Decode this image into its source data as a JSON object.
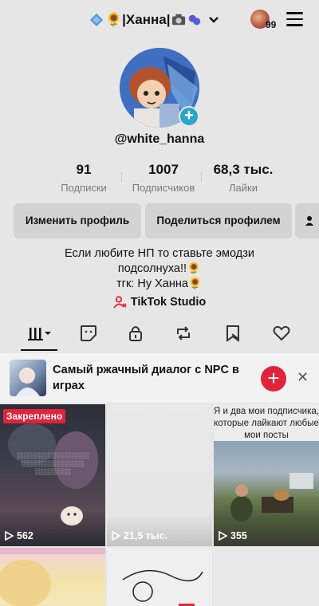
{
  "header": {
    "account_name": "🌻|Ханна|",
    "notifications_count": "99"
  },
  "profile": {
    "username": "@white_hanna",
    "stats": [
      {
        "value": "91",
        "label": "Подписки"
      },
      {
        "value": "1007",
        "label": "Подписчиков"
      },
      {
        "value": "68,3 тыс.",
        "label": "Лайки"
      }
    ],
    "edit_button": "Изменить профиль",
    "share_button": "Поделиться профилем",
    "bio": [
      "Если любите НП то ставьте эмодзи",
      "подсолнуха!!🌻",
      "тгк: Ну Ханна🌻"
    ],
    "studio_link": "TikTok Studio"
  },
  "playlist_banner": {
    "title": "Самый ржачный диалог с NPC в играх"
  },
  "videos": [
    {
      "pinned_label": "Закреплено",
      "views": "562"
    },
    {
      "views": "21,5 тыс."
    },
    {
      "caption": "Я и два мои подписчика, которые лайкают любые мои посты",
      "views": "355"
    }
  ],
  "colors": {
    "accent_red": "#e0243c",
    "add_badge": "#2aa6c6",
    "background": "#e6e6e6"
  }
}
